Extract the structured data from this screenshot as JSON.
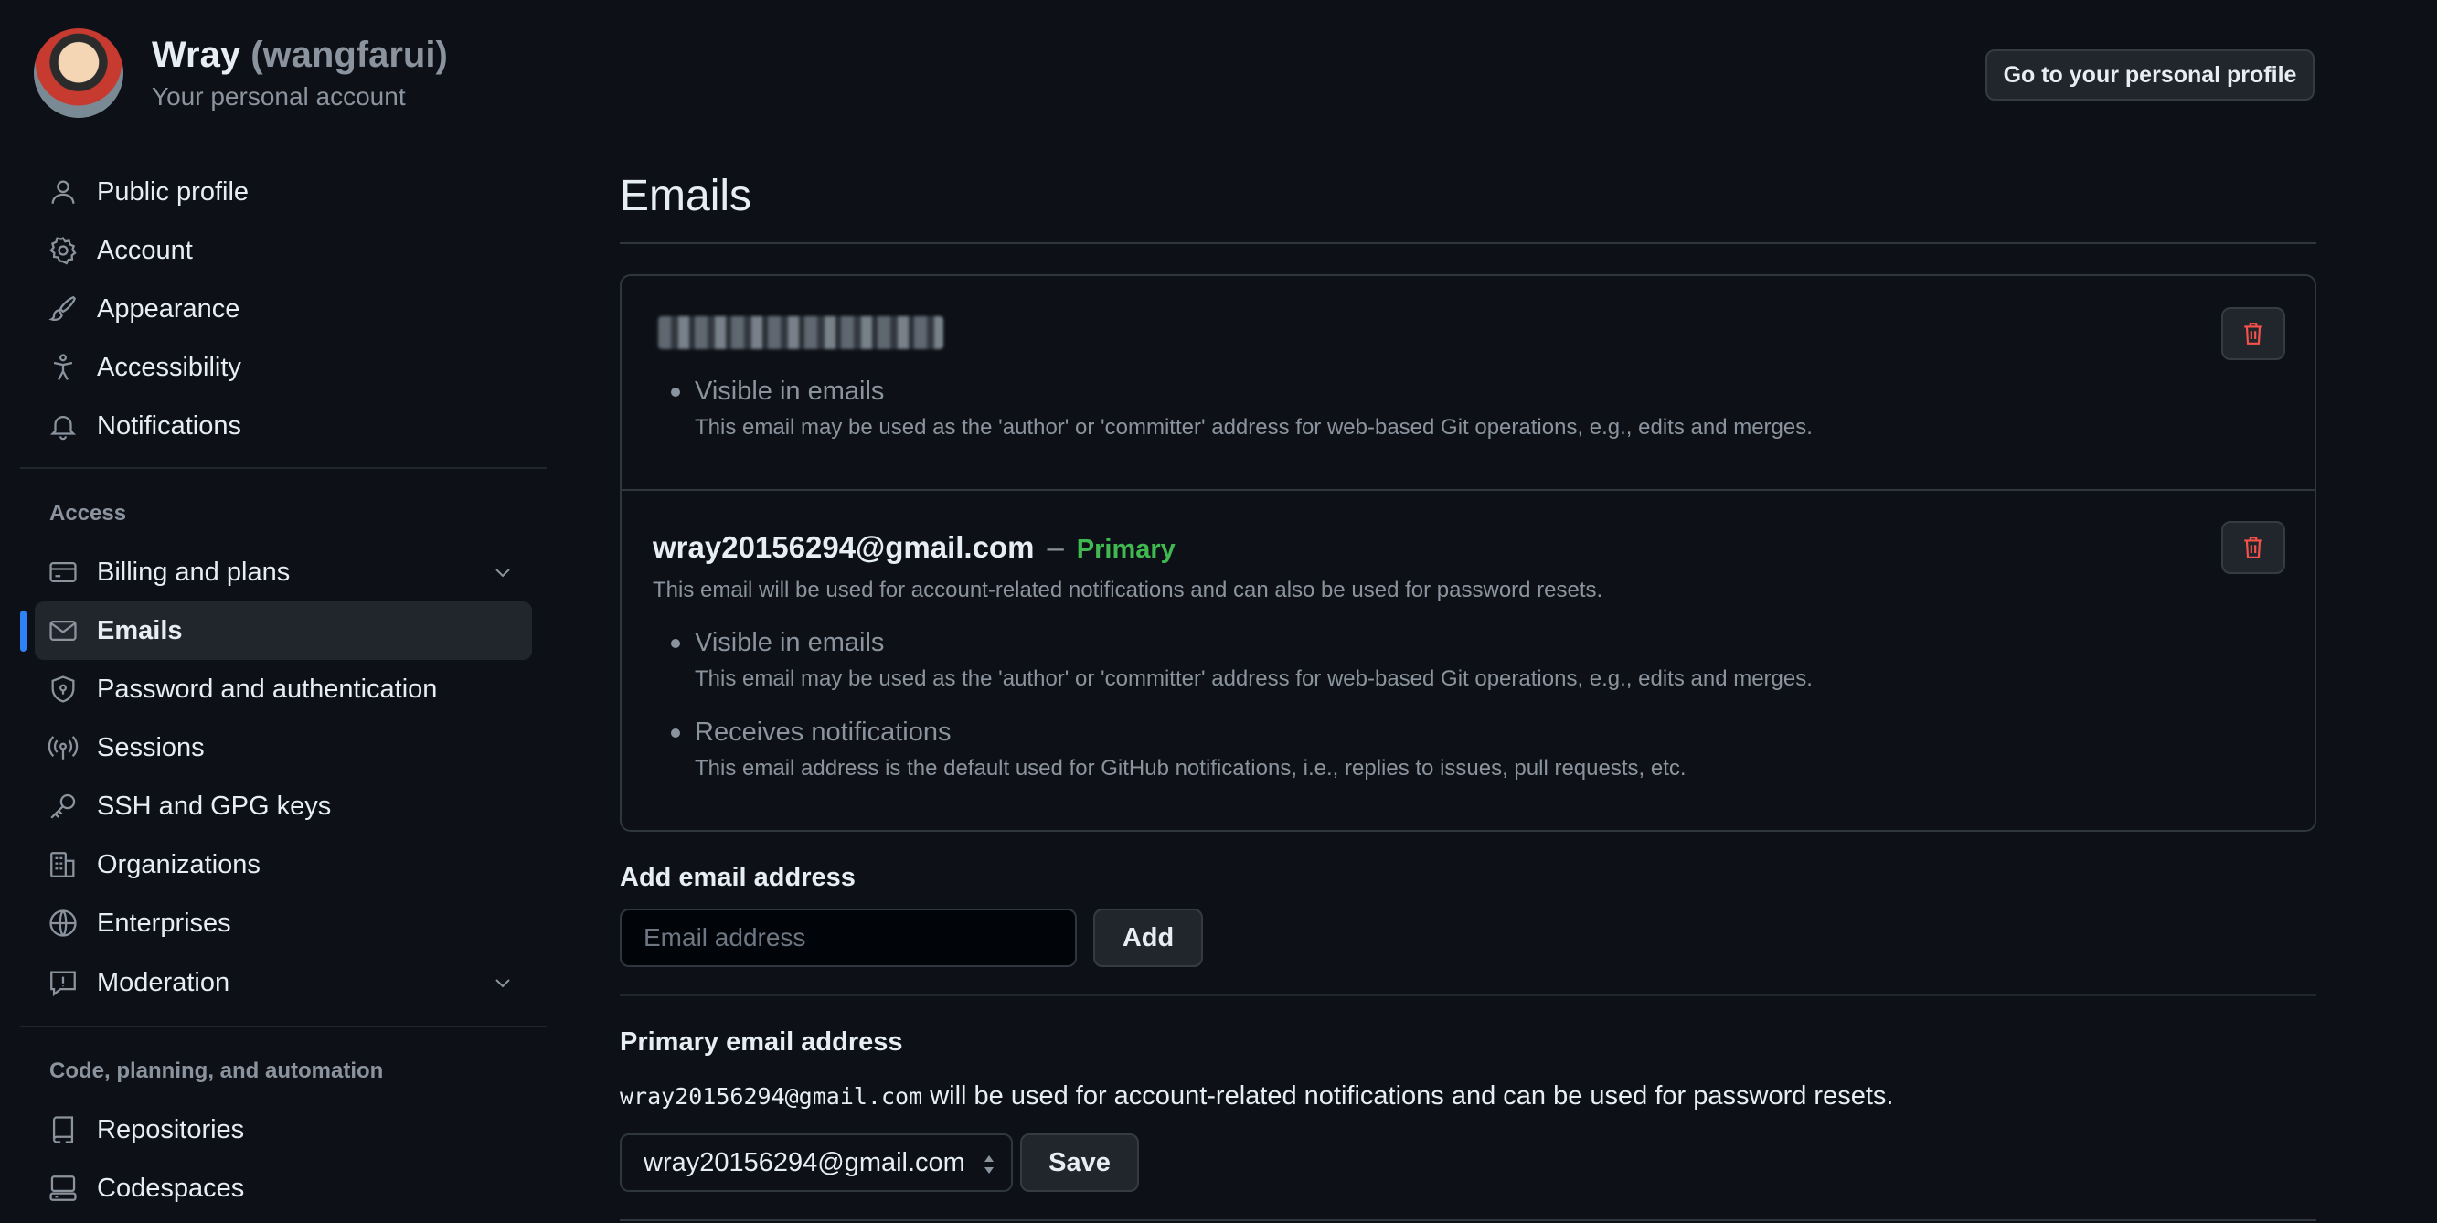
{
  "account": {
    "name": "Wray",
    "handle": "(wangfarui)",
    "subtitle": "Your personal account",
    "profile_button": "Go to your personal profile"
  },
  "sidebar": {
    "items": [
      {
        "label": "Public profile",
        "icon": "person-icon"
      },
      {
        "label": "Account",
        "icon": "gear-icon"
      },
      {
        "label": "Appearance",
        "icon": "paintbrush-icon"
      },
      {
        "label": "Accessibility",
        "icon": "accessibility-icon"
      },
      {
        "label": "Notifications",
        "icon": "bell-icon"
      }
    ],
    "access_heading": "Access",
    "access_items": [
      {
        "label": "Billing and plans",
        "icon": "credit-card-icon",
        "expandable": true
      },
      {
        "label": "Emails",
        "icon": "mail-icon",
        "active": true
      },
      {
        "label": "Password and authentication",
        "icon": "shield-lock-icon"
      },
      {
        "label": "Sessions",
        "icon": "broadcast-icon"
      },
      {
        "label": "SSH and GPG keys",
        "icon": "key-icon"
      },
      {
        "label": "Organizations",
        "icon": "organization-icon"
      },
      {
        "label": "Enterprises",
        "icon": "globe-icon"
      },
      {
        "label": "Moderation",
        "icon": "report-icon",
        "expandable": true
      }
    ],
    "code_heading": "Code, planning, and automation",
    "code_items": [
      {
        "label": "Repositories",
        "icon": "repo-icon"
      },
      {
        "label": "Codespaces",
        "icon": "codespaces-icon"
      }
    ]
  },
  "main": {
    "title": "Emails",
    "emails": [
      {
        "address_redacted": true,
        "bullets": [
          {
            "title": "Visible in emails",
            "desc": "This email may be used as the 'author' or 'committer' address for web-based Git operations, e.g., edits and merges."
          }
        ]
      },
      {
        "address": "wray20156294@gmail.com",
        "separator": "–",
        "badge": "Primary",
        "note": "This email will be used for account-related notifications and can also be used for password resets.",
        "bullets": [
          {
            "title": "Visible in emails",
            "desc": "This email may be used as the 'author' or 'committer' address for web-based Git operations, e.g., edits and merges."
          },
          {
            "title": "Receives notifications",
            "desc": "This email address is the default used for GitHub notifications, i.e., replies to issues, pull requests, etc."
          }
        ]
      }
    ],
    "add_email": {
      "label": "Add email address",
      "placeholder": "Email address",
      "value": "",
      "button": "Add"
    },
    "primary_email": {
      "label": "Primary email address",
      "address": "wray20156294@gmail.com",
      "text": " will be used for account-related notifications and can be used for password resets.",
      "selected": "wray20156294@gmail.com",
      "button": "Save"
    }
  },
  "colors": {
    "background": "#0d1117",
    "accent": "#2f81f7",
    "primary_badge": "#3fb950",
    "danger": "#f85149"
  }
}
